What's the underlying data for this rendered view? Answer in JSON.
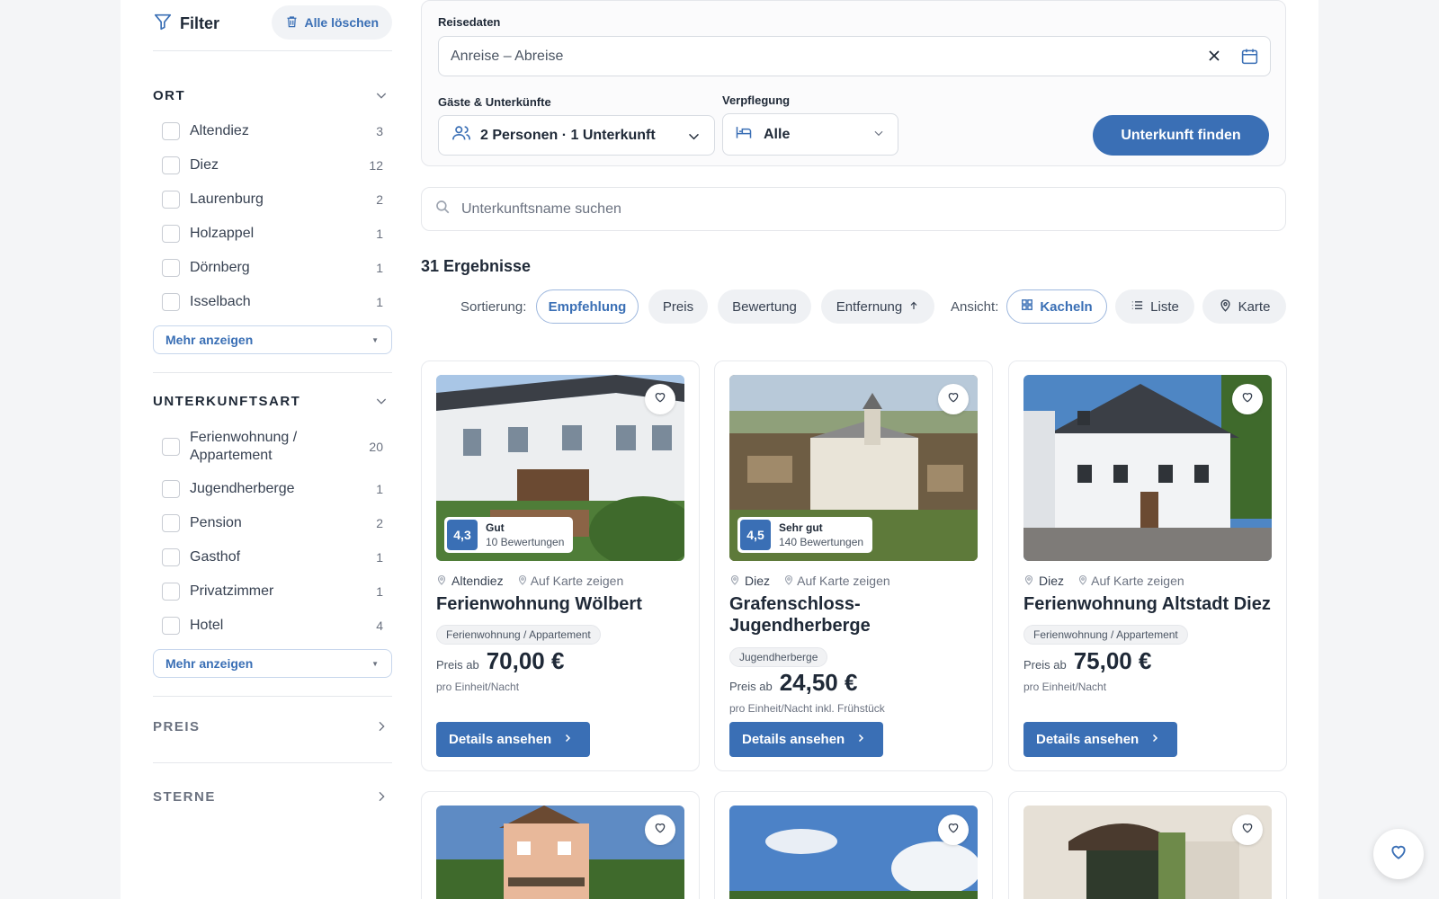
{
  "filter": {
    "title": "Filter",
    "clear_label": "Alle löschen",
    "sections": {
      "ort": {
        "title": "ORT",
        "options": [
          {
            "label": "Altendiez",
            "count": "3"
          },
          {
            "label": "Diez",
            "count": "12"
          },
          {
            "label": "Laurenburg",
            "count": "2"
          },
          {
            "label": "Holzappel",
            "count": "1"
          },
          {
            "label": "Dörnberg",
            "count": "1"
          },
          {
            "label": "Isselbach",
            "count": "1"
          }
        ],
        "more_label": "Mehr anzeigen"
      },
      "art": {
        "title": "UNTERKUNFTSART",
        "options": [
          {
            "label": "Ferienwohnung / Appartement",
            "count": "20"
          },
          {
            "label": "Jugendherberge",
            "count": "1"
          },
          {
            "label": "Pension",
            "count": "2"
          },
          {
            "label": "Gasthof",
            "count": "1"
          },
          {
            "label": "Privatzimmer",
            "count": "1"
          },
          {
            "label": "Hotel",
            "count": "4"
          }
        ],
        "more_label": "Mehr anzeigen"
      },
      "preis": {
        "title": "PREIS"
      },
      "sterne": {
        "title": "STERNE"
      }
    }
  },
  "search": {
    "dates_label": "Reisedaten",
    "dates_placeholder": "Anreise – Abreise",
    "guests_label": "Gäste & Unterkünfte",
    "guests_value": "2 Personen · 1 Unterkunft",
    "meals_label": "Verpflegung",
    "meals_value": "Alle",
    "find_label": "Unterkunft finden",
    "name_placeholder": "Unterkunftsname suchen"
  },
  "results": {
    "count_label": "31 Ergebnisse",
    "sort_label": "Sortierung:",
    "sort_options": [
      "Empfehlung",
      "Preis",
      "Bewertung",
      "Entfernung"
    ],
    "sort_active": "Empfehlung",
    "view_label": "Ansicht:",
    "view_options": [
      "Kacheln",
      "Liste",
      "Karte"
    ],
    "view_active": "Kacheln"
  },
  "cards": [
    {
      "score": "4,3",
      "rating_word": "Gut",
      "reviews": "10 Bewertungen",
      "location": "Altendiez",
      "map_label": "Auf Karte zeigen",
      "title": "Ferienwohnung Wölbert",
      "type": "Ferienwohnung / Appartement",
      "price_from": "Preis ab",
      "price": "70,00 €",
      "unit": "pro Einheit/Nacht",
      "details_label": "Details ansehen"
    },
    {
      "score": "4,5",
      "rating_word": "Sehr gut",
      "reviews": "140 Bewertungen",
      "location": "Diez",
      "map_label": "Auf Karte zeigen",
      "title": "Grafenschloss-Jugendherberge",
      "type": "Jugendherberge",
      "price_from": "Preis ab",
      "price": "24,50 €",
      "unit": "pro Einheit/Nacht inkl. Frühstück",
      "details_label": "Details ansehen"
    },
    {
      "location": "Diez",
      "map_label": "Auf Karte zeigen",
      "title": "Ferienwohnung Altstadt Diez",
      "type": "Ferienwohnung / Appartement",
      "price_from": "Preis ab",
      "price": "75,00 €",
      "unit": "pro Einheit/Nacht",
      "details_label": "Details ansehen"
    }
  ],
  "colors": {
    "accent": "#3a6fb5"
  }
}
